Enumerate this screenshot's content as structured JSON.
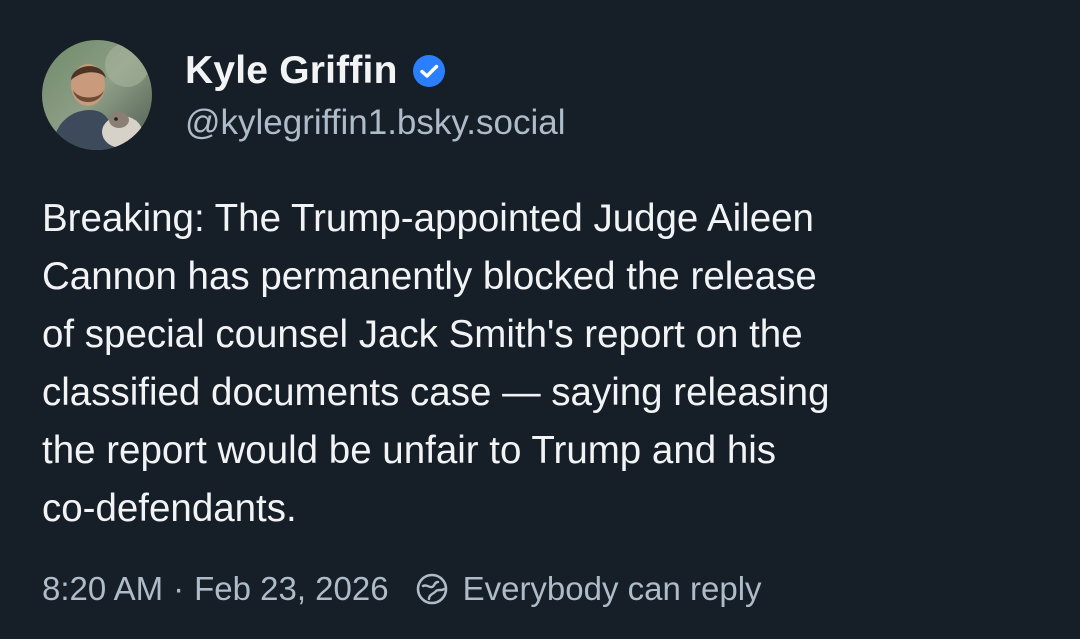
{
  "author": {
    "display_name": "Kyle Griffin",
    "handle": "@kylegriffin1.bsky.social",
    "verified_icon": "verified-check-icon",
    "avatar_icon": "user-avatar"
  },
  "post": {
    "text_lines": [
      "Breaking: The Trump-appointed Judge Aileen",
      "Cannon has permanently blocked the release",
      "of special counsel Jack Smith's report on the",
      "classified documents case — saying releasing",
      "the report would be unfair to Trump and his",
      "co-defendants."
    ]
  },
  "meta": {
    "time": "8:20 AM",
    "separator": "·",
    "date": "Feb 23, 2026",
    "reply_setting": "Everybody can reply",
    "reply_icon": "globe-reply-icon"
  },
  "colors": {
    "background": "#161e27",
    "text": "#f1f3f5",
    "muted": "#aebbc9",
    "verified": "#2a7fff"
  }
}
